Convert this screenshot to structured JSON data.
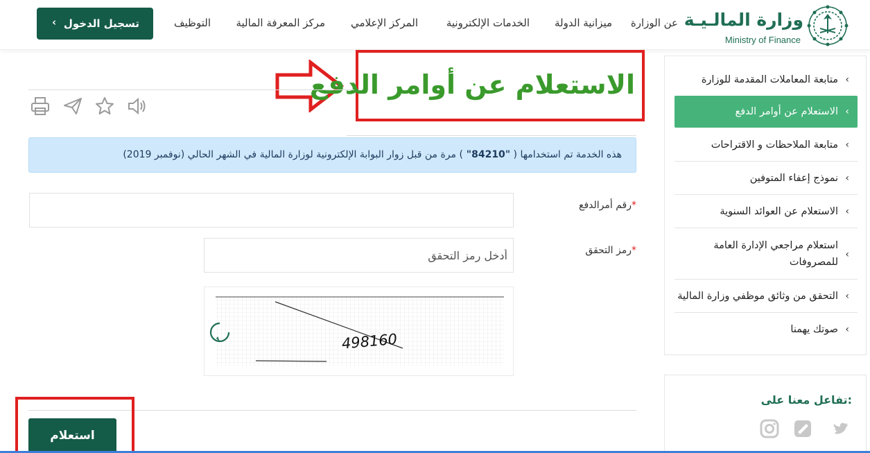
{
  "header": {
    "logo_ar": "وزارة المالـيـة",
    "logo_en": "Ministry of Finance",
    "nav": [
      {
        "label": "عن الوزارة"
      },
      {
        "label": "ميزانية الدولة"
      },
      {
        "label": "الخدمات الإلكترونية"
      },
      {
        "label": "المركز الإعلامي"
      },
      {
        "label": "مركز المعرفة المالية"
      },
      {
        "label": "التوظيف"
      }
    ],
    "login_label": "تسجيل الدخول"
  },
  "sidebar": {
    "items": [
      {
        "label": "متابعة المعاملات المقدمة للوزارة"
      },
      {
        "label": "الاستعلام عن أوامر الدفع"
      },
      {
        "label": "متابعة الملاحظات و الاقتراحات"
      },
      {
        "label": "نموذج إعفاء المتوفين"
      },
      {
        "label": "الاستعلام عن العوائد السنوية"
      },
      {
        "label": "استعلام مراجعي الإدارة العامة للمصروفات"
      },
      {
        "label": "التحقق من وثائق موظفي وزارة المالية"
      },
      {
        "label": "صوتك يهمنا"
      }
    ],
    "active_index": 1,
    "social_title": "تفاعل معنا على:"
  },
  "main": {
    "title": "الاستعلام عن أوامر الدفع",
    "info": {
      "prefix": "هذه الخدمة تم استخدامها ( ",
      "count": "\"84210\" ",
      "suffix": ") مرة من قبل زوار البوابة الإلكترونية لوزارة المالية في الشهر الحالي (نوفمبر 2019)"
    },
    "payment_order_label": "رقم أمرالدفع",
    "payment_order_value": "",
    "captcha_label": "رمز التحقق",
    "captcha_placeholder": "أدخل رمز التحقق",
    "captcha_text": "498160",
    "submit_label": "استعلام",
    "required_mark": "*"
  },
  "colors": {
    "brand_dark_green": "#145b48",
    "active_green": "#46b37a",
    "title_green": "#3a9a2c",
    "annotation_red": "#e02020",
    "info_blue": "#cfe8fb"
  }
}
